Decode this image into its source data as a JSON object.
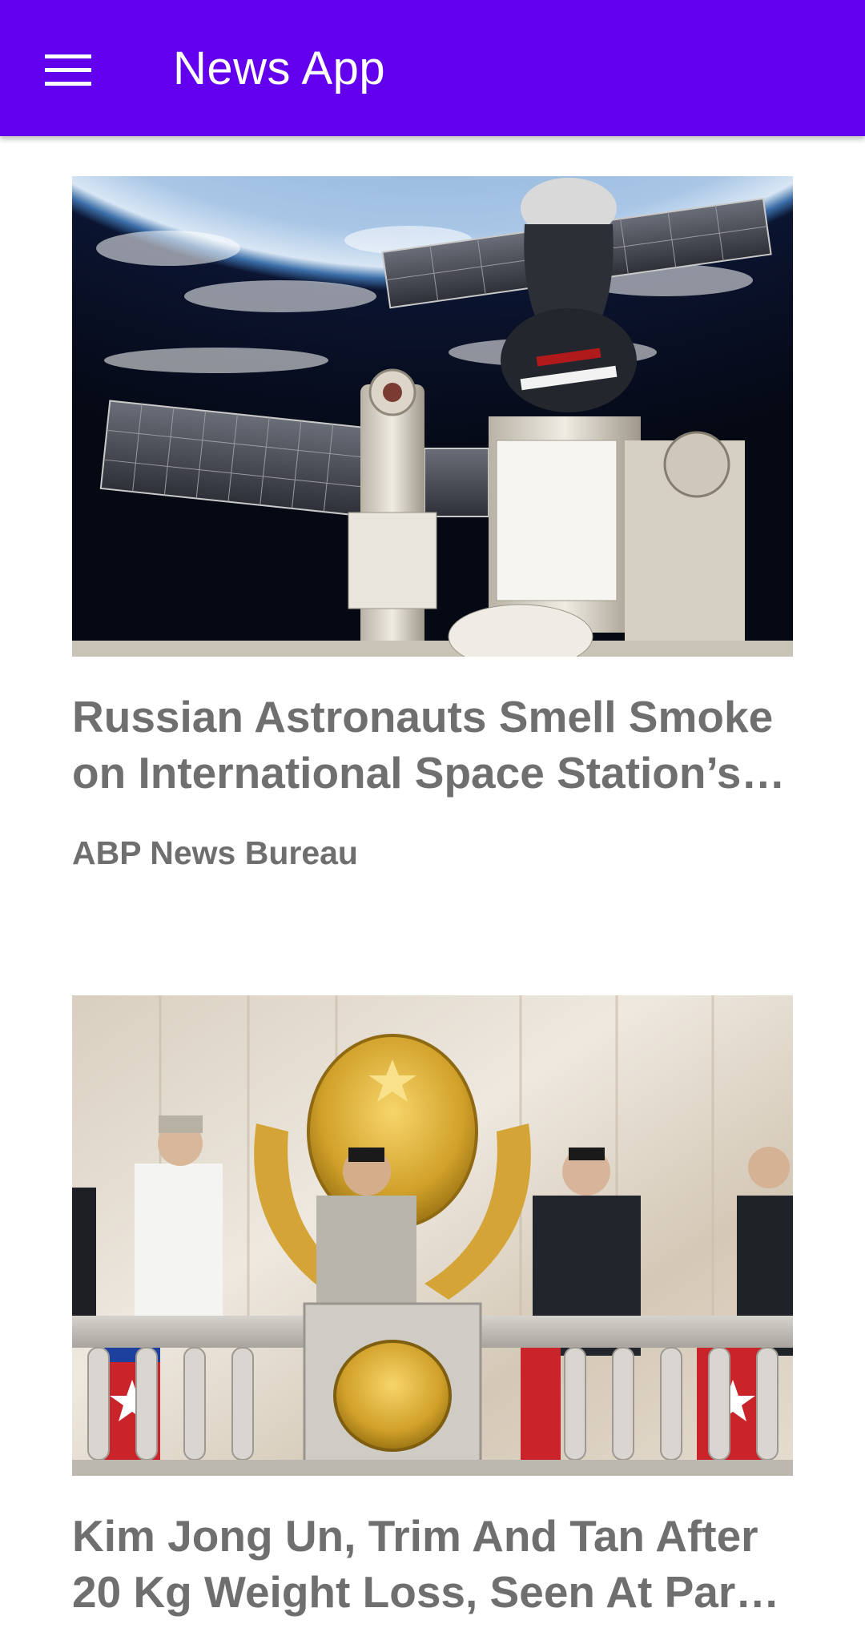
{
  "app_bar": {
    "title": "News App",
    "menu_icon": "hamburger-menu-icon",
    "background_color": "#6200EE"
  },
  "articles": [
    {
      "headline": "Russian Astronauts Smell Smoke on International Space Station’s…",
      "source": "ABP News Bureau",
      "image": "space-station-photo"
    },
    {
      "headline": "Kim Jong Un, Trim And Tan After 20 Kg Weight Loss, Seen At Par…",
      "image": "parade-balcony-photo"
    }
  ]
}
